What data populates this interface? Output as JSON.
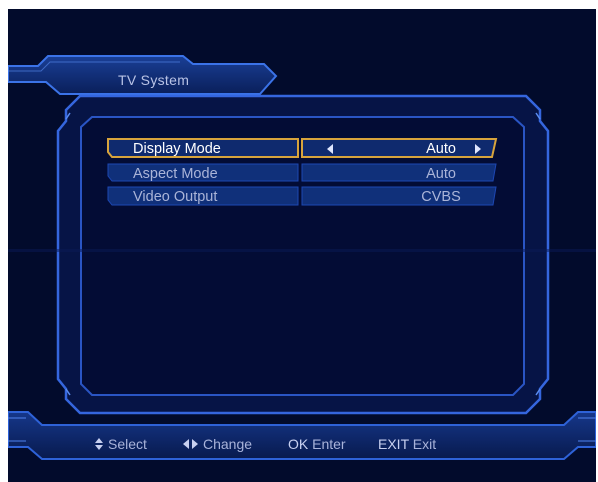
{
  "header": {
    "title": "TV System"
  },
  "settings": [
    {
      "label": "Display Mode",
      "value": "Auto",
      "selected": true
    },
    {
      "label": "Aspect Mode",
      "value": "Auto",
      "selected": false
    },
    {
      "label": "Video Output",
      "value": "CVBS",
      "selected": false
    }
  ],
  "footer": {
    "select_key_icon": "up-down-arrows-icon",
    "select_label": "Select",
    "change_key_icon": "left-right-arrows-icon",
    "change_label": "Change",
    "enter_key": "OK",
    "enter_label": "Enter",
    "exit_key": "EXIT",
    "exit_label": "Exit"
  },
  "colors": {
    "background": "#020b2c",
    "frame_blue": "#2f64d8",
    "selection_gold": "#d8a43c",
    "row_fill": "#10307a"
  }
}
